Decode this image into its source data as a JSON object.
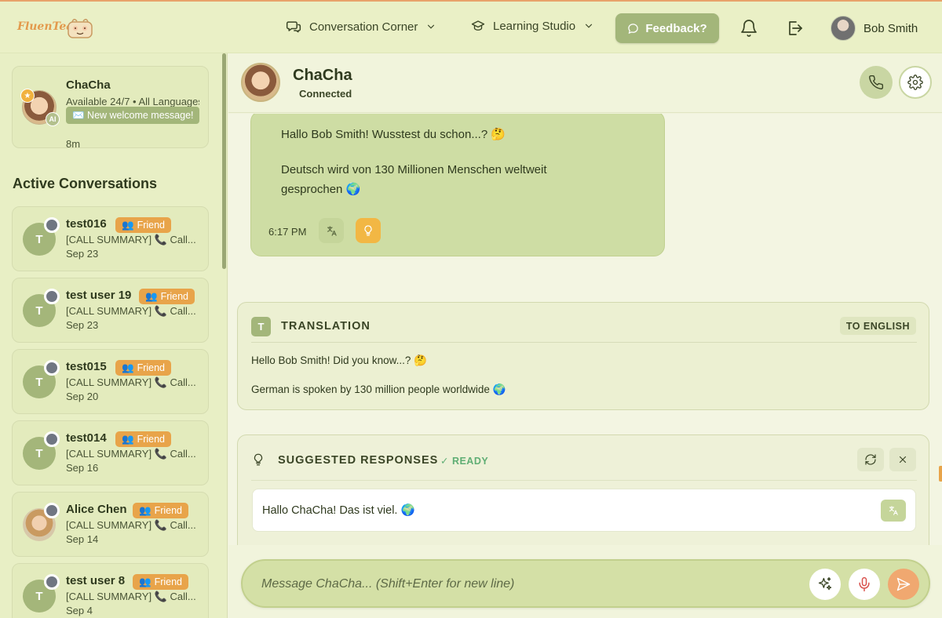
{
  "app": {
    "logo_text": "FluenTea"
  },
  "nav": {
    "conversation_corner": "Conversation Corner",
    "learning_studio": "Learning Studio",
    "feedback": "Feedback?",
    "user_name": "Bob Smith"
  },
  "sidebar": {
    "ai_card": {
      "name": "ChaCha",
      "status": "Available 24/7 • All Languages",
      "welcome": "✉️ New welcome message!",
      "time": "8m",
      "badge": "AI",
      "badge_star": "★"
    },
    "section_title": "Active Conversations",
    "conversations": [
      {
        "initial": "T",
        "name": "test016",
        "badge": "Friend",
        "summary": "[CALL SUMMARY] 📞 Call...",
        "date": "Sep 23"
      },
      {
        "initial": "T",
        "name": "test user 19",
        "badge": "Friend",
        "summary": "[CALL SUMMARY] 📞 Call...",
        "date": "Sep 23"
      },
      {
        "initial": "T",
        "name": "test015",
        "badge": "Friend",
        "summary": "[CALL SUMMARY] 📞 Call...",
        "date": "Sep 20"
      },
      {
        "initial": "T",
        "name": "test014",
        "badge": "Friend",
        "summary": "[CALL SUMMARY] 📞 Call...",
        "date": "Sep 16"
      },
      {
        "initial": "",
        "name": "Alice Chen",
        "badge": "Friend",
        "summary": "[CALL SUMMARY] 📞 Call...",
        "date": "Sep 14"
      },
      {
        "initial": "T",
        "name": "test user 8",
        "badge": "Friend",
        "summary": "[CALL SUMMARY] 📞 Call...",
        "date": "Sep 4"
      }
    ]
  },
  "chat": {
    "name": "ChaCha",
    "status": "Connected",
    "message": {
      "line1": "Hallo Bob Smith! Wusstest du schon...? 🤔",
      "line2": "Deutsch wird von 130 Millionen Menschen weltweit gesprochen 🌍",
      "time": "6:17 PM"
    },
    "translation": {
      "badge": "T",
      "title": "TRANSLATION",
      "target": "TO ENGLISH",
      "line1": "Hello Bob Smith! Did you know...? 🤔",
      "line2": "German is spoken by 130 million people worldwide 🌍"
    },
    "suggestions": {
      "title": "SUGGESTED RESPONSES",
      "status": "✓ READY",
      "items": [
        {
          "text": "Hallo ChaCha! Das ist viel. 🌍"
        }
      ]
    },
    "composer": {
      "placeholder": "Message ChaCha... (Shift+Enter for new line)"
    }
  },
  "colors": {
    "accent_green": "#a3b67a",
    "friend_orange": "#e8a44a",
    "bubble_green": "#cedda4",
    "ready_green": "#5fae74",
    "send_orange": "#f0a870"
  },
  "icons": {
    "nav": [
      "chat-bubbles-icon",
      "chevron-down-icon",
      "graduation-cap-icon",
      "comment-icon",
      "bell-icon",
      "logout-icon"
    ],
    "chat": [
      "phone-icon",
      "gear-icon",
      "translate-icon",
      "lightbulb-icon",
      "refresh-icon",
      "close-icon",
      "sparkles-icon",
      "microphone-icon",
      "send-icon"
    ]
  }
}
